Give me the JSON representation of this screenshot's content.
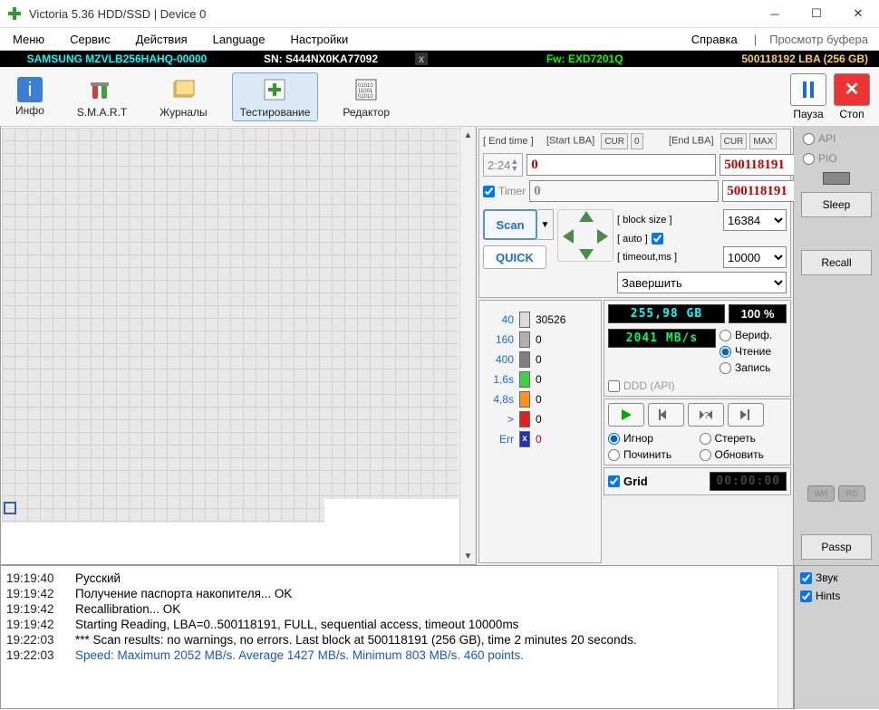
{
  "title": "Victoria 5.36 HDD/SSD | Device 0",
  "menu": {
    "items": [
      "Меню",
      "Сервис",
      "Действия",
      "Language",
      "Настройки"
    ],
    "help": "Справка",
    "buffer": "Просмотр буфера"
  },
  "status": {
    "device": "SAMSUNG MZVLB256HAHQ-00000",
    "sn": "SN: S444NX0KA77092",
    "fw": "Fw: EXD7201Q",
    "lba": "500118192 LBA (256 GB)"
  },
  "toolbar": {
    "info": "Инфо",
    "smart": "S.M.A.R.T",
    "journals": "Журналы",
    "test": "Тестирование",
    "editor": "Редактор",
    "pause": "Пауза",
    "stop": "Стоп"
  },
  "ctrl": {
    "endtime_hdr": "[ End time ]",
    "startlba_hdr": "[Start LBA]",
    "endlba_hdr": "[End LBA]",
    "cur": "CUR",
    "zero": "0",
    "max": "MAX",
    "timer_time": "2:24",
    "start_lba": "0",
    "end_lba": "500118191",
    "timer_label": "Timer",
    "timer_ro": "0",
    "end_ro": "500118191",
    "scan": "Scan",
    "quick": "QUICK",
    "blocksize_hdr": "[ block size ]",
    "auto_hdr": "[ auto ]",
    "timeout_hdr": "[ timeout,ms ]",
    "blocksize": "16384",
    "timeout": "10000",
    "action": "Завершить"
  },
  "blocks": {
    "items": [
      {
        "left": "40",
        "color": "#dcdcdc",
        "count": "30526"
      },
      {
        "left": "160",
        "color": "#b0b0b0",
        "count": "0"
      },
      {
        "left": "400",
        "color": "#808080",
        "count": "0"
      },
      {
        "left": "1,6s",
        "color": "#40d040",
        "count": "0"
      },
      {
        "left": "4,8s",
        "color": "#ff9020",
        "count": "0"
      },
      {
        "left": ">",
        "color": "#e02020",
        "count": "0"
      },
      {
        "left": "Err",
        "color": "#2030c0",
        "count": "0",
        "x": true
      }
    ]
  },
  "stats": {
    "size": "255,98 GB",
    "percent": "100  %",
    "speed": "2041 MB/s",
    "ddd": "DDD (API)",
    "verify": "Вериф.",
    "read": "Чтение",
    "write": "Запись",
    "ignore": "Игнор",
    "erase": "Стереть",
    "repair": "Починить",
    "refresh": "Обновить",
    "grid": "Grid",
    "clock": "00:00:00"
  },
  "side": {
    "api": "API",
    "pio": "PIO",
    "sleep": "Sleep",
    "recall": "Recall",
    "passp": "Passp",
    "wr": "WR",
    "rd": "RD",
    "sound": "Звук",
    "hints": "Hints"
  },
  "log": {
    "lines": [
      {
        "ts": "19:19:40",
        "msg": "Русский"
      },
      {
        "ts": "19:19:42",
        "msg": "Получение паспорта накопителя... OK"
      },
      {
        "ts": "19:19:42",
        "msg": "Recallibration... OK"
      },
      {
        "ts": "19:19:42",
        "msg": "Starting Reading, LBA=0..500118191, FULL, sequential access, timeout 10000ms"
      },
      {
        "ts": "19:22:03",
        "msg": "*** Scan results: no warnings, no errors. Last block at 500118191 (256 GB), time 2 minutes 20 seconds."
      },
      {
        "ts": "19:22:03",
        "msg": "Speed: Maximum 2052 MB/s. Average 1427 MB/s. Minimum 803 MB/s. 460 points.",
        "blue": true
      }
    ]
  }
}
